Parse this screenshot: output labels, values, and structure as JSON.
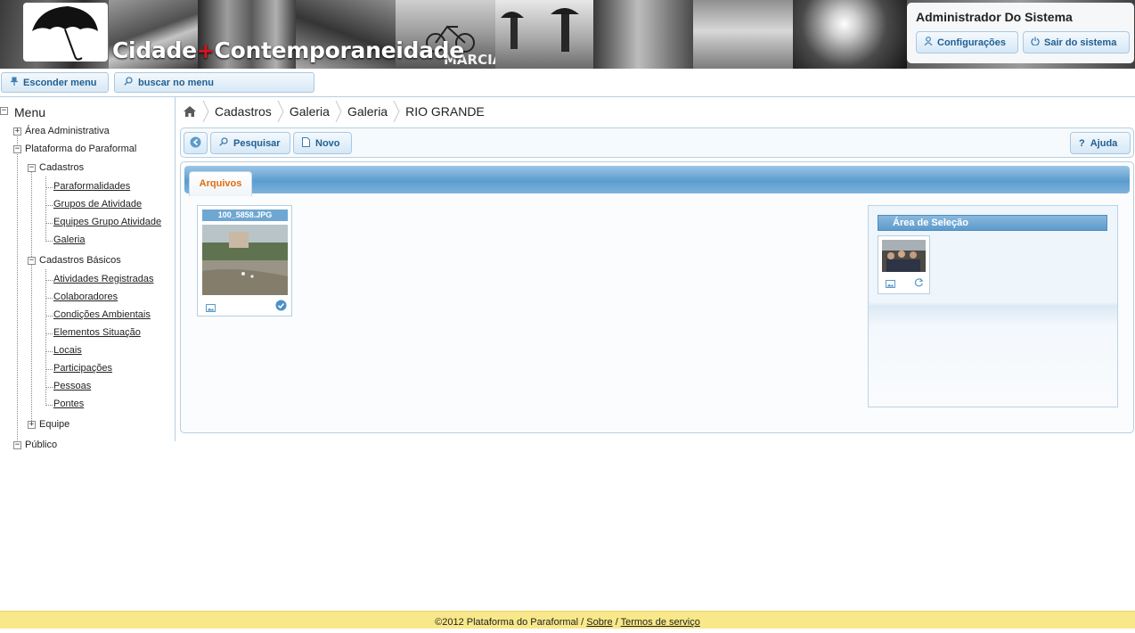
{
  "header": {
    "site_title_part1": "Cidade",
    "site_title_plus": "+",
    "site_title_part2": "Contemporaneidade",
    "photo_text_1": "MARCIA",
    "user_name": "Administrador Do Sistema",
    "settings_label": "Configurações",
    "logout_label": "Sair do sistema"
  },
  "menu_toolbar": {
    "hide_menu_label": "Esconder menu",
    "search_placeholder": "buscar no menu"
  },
  "sidebar": {
    "root_label": "Menu",
    "area_admin": "Área Administrativa",
    "plataforma": "Plataforma do Paraformal",
    "cadastros": "Cadastros",
    "cadastros_items": [
      "Paraformalidades",
      "Grupos de Atividade",
      "Equipes Grupo Atividade",
      "Galeria"
    ],
    "cadastros_basicos": "Cadastros Básicos",
    "basicos_items": [
      "Atividades Registradas",
      "Colaboradores",
      "Condições Ambientais",
      "Elementos Situação",
      "Locais",
      "Participações",
      "Pessoas",
      "Pontes"
    ],
    "equipe": "Equipe",
    "publico": "Público"
  },
  "breadcrumb": [
    "Cadastros",
    "Galeria",
    "Galeria",
    "RIO GRANDE"
  ],
  "actions": {
    "search_label": "Pesquisar",
    "new_label": "Novo",
    "help_label": "Ajuda"
  },
  "tabs": [
    {
      "label": "Arquivos",
      "active": true
    }
  ],
  "files": [
    {
      "name": "100_5858.JPG"
    }
  ],
  "selection": {
    "title": "Área de Seleção"
  },
  "footer": {
    "copyright": "©2012 Plataforma do Paraformal",
    "sep1": "/",
    "about_link": "Sobre",
    "sep2": "/",
    "terms_link": "Termos de serviço"
  },
  "colors": {
    "accent_blue": "#1f5f93",
    "tab_active": "#e06d0e",
    "footer_bg": "#f8e88a",
    "title_plus": "#d8141c"
  }
}
